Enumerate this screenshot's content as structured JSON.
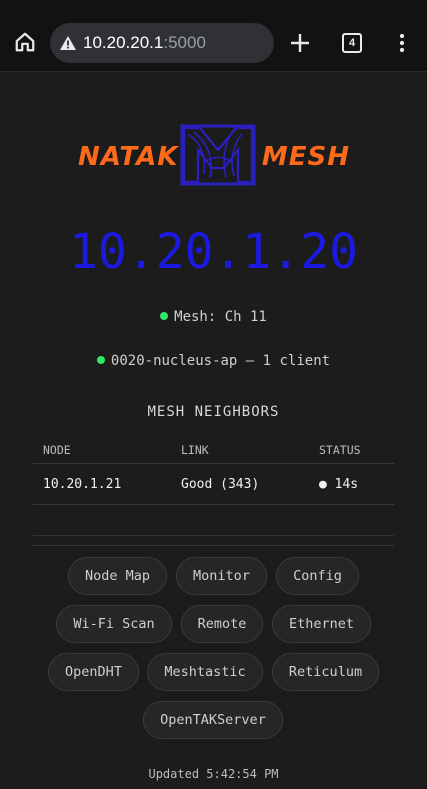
{
  "browser": {
    "url_host": "10.20.20.1",
    "url_port": ":5000",
    "tab_count": "4",
    "icons": [
      "home-icon",
      "lock-icon",
      "plus-icon",
      "tabs-icon",
      "more-vert-icon"
    ]
  },
  "logo": {
    "left": "NATAK",
    "right": "MESH",
    "colors": {
      "text": "#ff6a1a",
      "mark": "#2a1fc0"
    }
  },
  "node_ip": "10.20.1.20",
  "mesh_status": "Mesh: Ch 11",
  "ap_status": "0020-nucleus-ap — 1 client",
  "neighbors": {
    "title": "MESH NEIGHBORS",
    "headers": {
      "node": "NODE",
      "link": "LINK",
      "status": "STATUS"
    },
    "rows": [
      {
        "node": "10.20.1.21",
        "link": "Good (343)",
        "status": "● 14s"
      }
    ]
  },
  "buttons": {
    "node_map": "Node Map",
    "monitor": "Monitor",
    "config": "Config",
    "wifi_scan": "Wi-Fi Scan",
    "remote": "Remote",
    "ethernet": "Ethernet",
    "opendht": "OpenDHT",
    "meshtastic": "Meshtastic",
    "reticulum": "Reticulum",
    "opentakserver": "OpenTAKServer"
  },
  "updated": "Updated 5:42:54 PM",
  "colors": {
    "ip": "#1c1ae0",
    "good": "#2ee866",
    "background": "#1c1c1c"
  }
}
